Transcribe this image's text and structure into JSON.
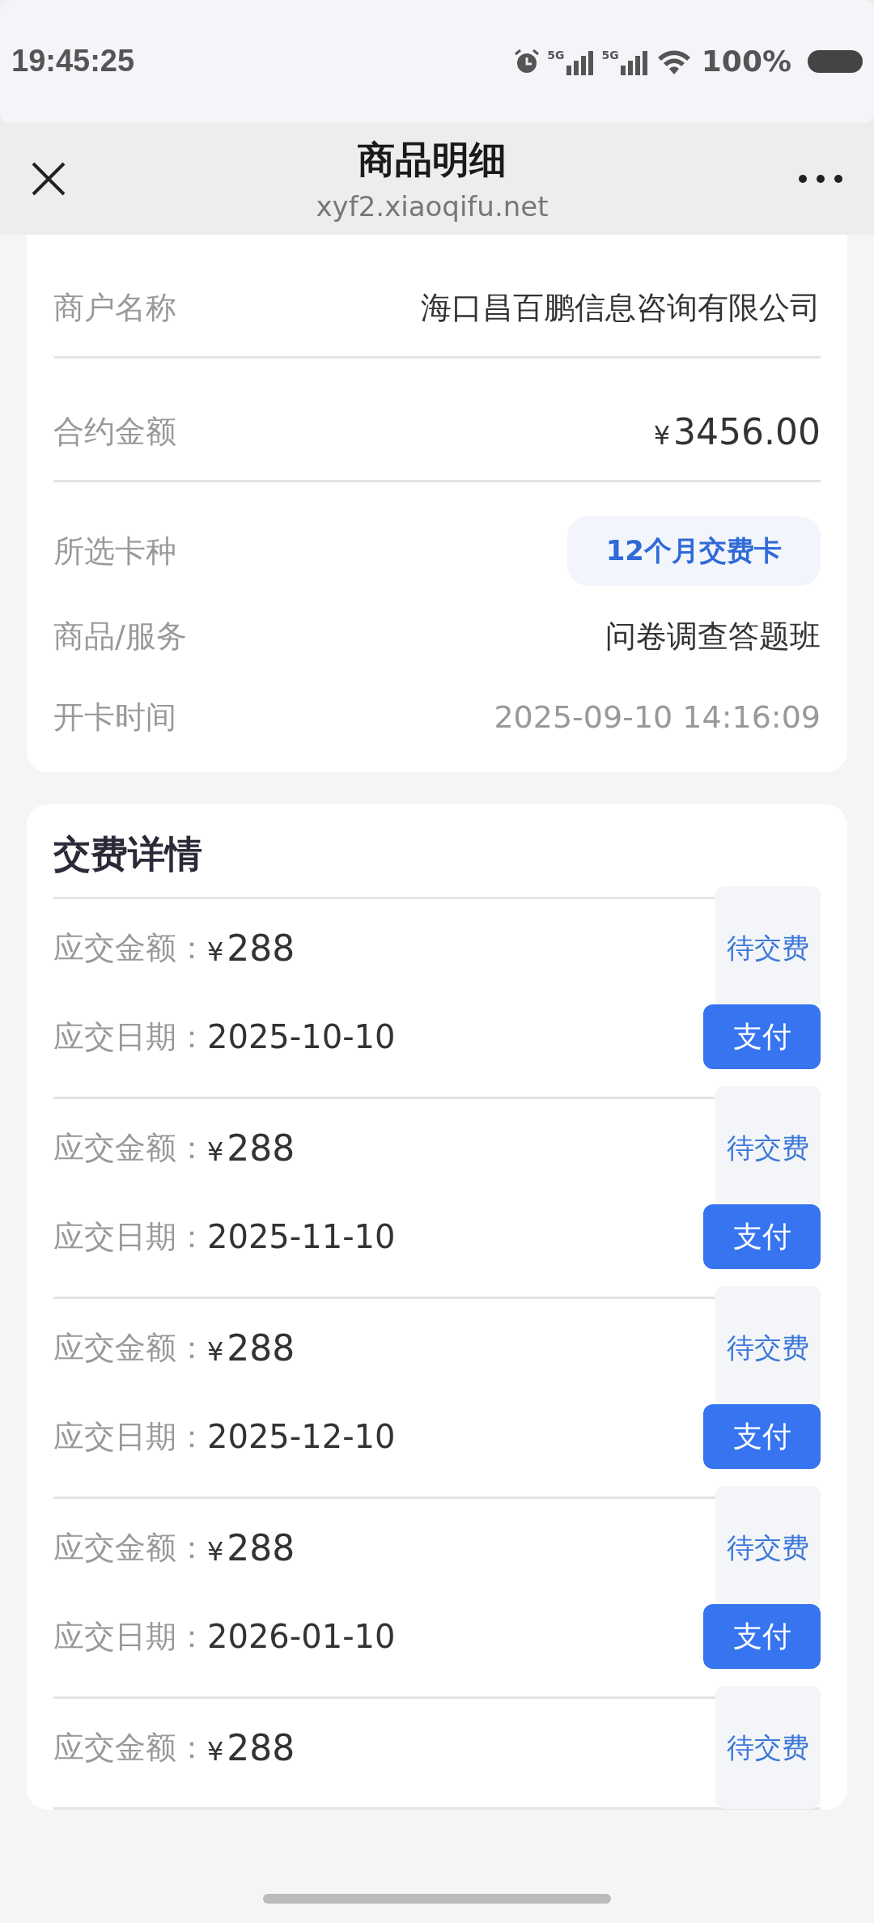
{
  "status_bar": {
    "time": "19:45:25",
    "sim_labels": [
      "5G",
      "5G"
    ],
    "battery": "100%"
  },
  "header": {
    "title": "商品明细",
    "subtitle": "xyf2.xiaoqifu.net"
  },
  "order_info": {
    "rows": [
      {
        "kind": "text",
        "label": "商户名称",
        "value": "海口昌百鹏信息咨询有限公司",
        "divider": true
      },
      {
        "kind": "money",
        "label": "合约金额",
        "currency": "¥",
        "value": "3456.00",
        "divider": true
      },
      {
        "kind": "tag",
        "label": "所选卡种",
        "value": "12个月交费卡",
        "divider": false
      },
      {
        "kind": "text",
        "label": "商品/服务",
        "value": "问卷调查答题班",
        "divider": false
      },
      {
        "kind": "muted",
        "label": "开卡时间",
        "value": "2025-09-10 14:16:09",
        "divider": false
      }
    ]
  },
  "payment_details": {
    "title": "交费详情",
    "items": [
      {
        "amount_label": "应交金额：",
        "currency": "¥",
        "amount": "288",
        "status": "待交费",
        "date_label": "应交日期：",
        "date": "2025-10-10",
        "pay_button": "支付"
      },
      {
        "amount_label": "应交金额：",
        "currency": "¥",
        "amount": "288",
        "status": "待交费",
        "date_label": "应交日期：",
        "date": "2025-11-10",
        "pay_button": "支付"
      },
      {
        "amount_label": "应交金额：",
        "currency": "¥",
        "amount": "288",
        "status": "待交费",
        "date_label": "应交日期：",
        "date": "2025-12-10",
        "pay_button": "支付"
      },
      {
        "amount_label": "应交金额：",
        "currency": "¥",
        "amount": "288",
        "status": "待交费",
        "date_label": "应交日期：",
        "date": "2026-01-10",
        "pay_button": "支付"
      },
      {
        "amount_label": "应交金额：",
        "currency": "¥",
        "amount": "288",
        "status": "待交费"
      }
    ]
  }
}
